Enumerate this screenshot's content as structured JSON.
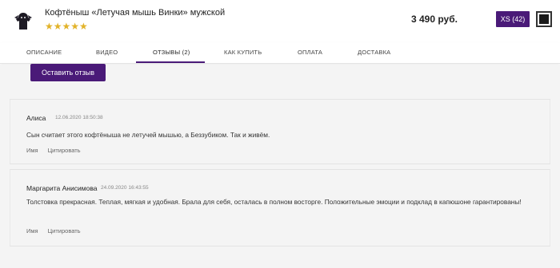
{
  "header": {
    "product_title": "Кофтёныш «Летучая мышь Винки» мужской",
    "rating_stars": "★★★★★",
    "price": "3 490 руб.",
    "size_button": "XS (42)",
    "thumbnail_icon": "product-thumbnail-icon",
    "colors": {
      "accent": "#4a1a78",
      "star": "#e2b32a"
    }
  },
  "tabs": [
    {
      "label": "ОПИСАНИЕ"
    },
    {
      "label": "ВИДЕО"
    },
    {
      "label": "ОТЗЫВЫ (2)"
    },
    {
      "label": "КАК КУПИТЬ"
    },
    {
      "label": "ОПЛАТА"
    },
    {
      "label": "ДОСТАВКА"
    }
  ],
  "active_tab": "ОТЗЫВЫ (2)",
  "reviews_section": {
    "leave_review_label": "Оставить отзыв",
    "reviews": [
      {
        "author": "Алиса",
        "date": "12.06.2020 18:50:38",
        "text": "Сын считает этого кофтёныша не летучей мышью, а Беззубиком. Так и живём.",
        "actions": [
          "Имя",
          "Цитировать"
        ]
      },
      {
        "author": "Маргарита Анисимова",
        "date": "24.09.2020 16:43:55",
        "text": "Толстовка прекрасная. Теплая, мягкая и удобная. Брала для себя, осталась в полном восторге. Положительные эмоции и подклад в капюшоне гарантированы!",
        "actions": [
          "Имя",
          "Цитировать"
        ]
      }
    ]
  }
}
